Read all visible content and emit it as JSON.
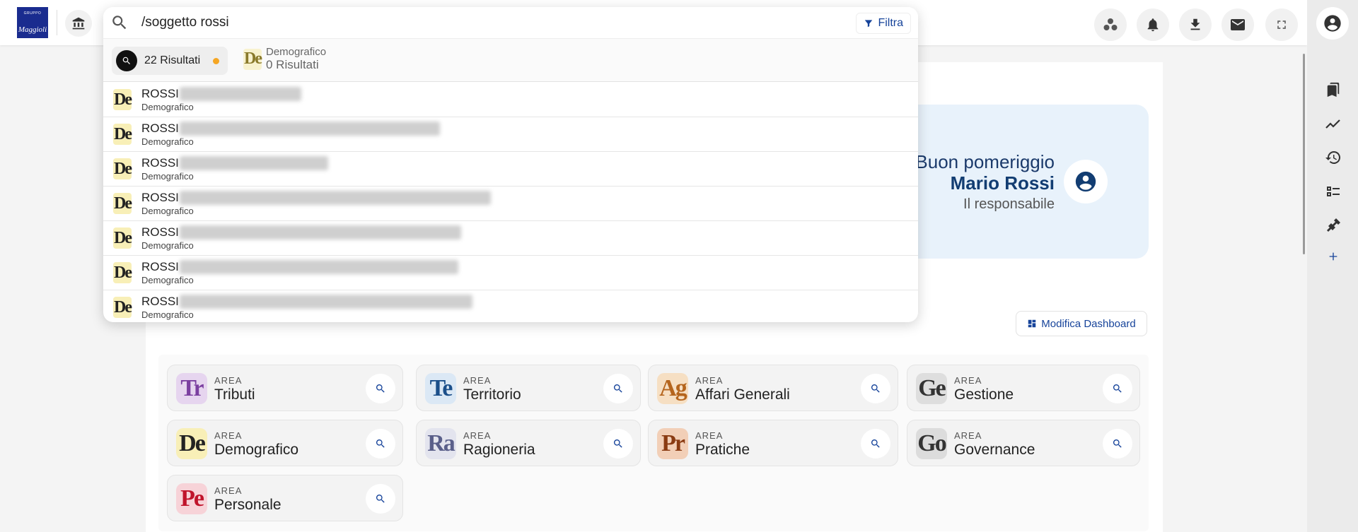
{
  "header": {
    "logo_top": "GRUPPO",
    "logo_text": "Maggioli"
  },
  "search": {
    "query": "/soggetto rossi",
    "filter_label": "Filtra",
    "tabs": [
      {
        "label": "22 Risultati"
      },
      {
        "category": "Demografico",
        "count_label": "0 Risultati"
      }
    ],
    "results": [
      {
        "name": "ROSSI",
        "category": "Demografico"
      },
      {
        "name": "ROSSI",
        "category": "Demografico"
      },
      {
        "name": "ROSSI",
        "category": "Demografico"
      },
      {
        "name": "ROSSI",
        "category": "Demografico"
      },
      {
        "name": "ROSSI",
        "category": "Demografico"
      },
      {
        "name": "ROSSI",
        "category": "Demografico"
      },
      {
        "name": "ROSSI",
        "category": "Demografico"
      }
    ],
    "result_badge": "De"
  },
  "welcome": {
    "greeting": "Buon pomeriggio",
    "user_name": "Mario Rossi",
    "role": "Il responsabile"
  },
  "dashboard": {
    "edit_label": "Modifica Dashboard"
  },
  "areas": [
    {
      "kicker": "AREA",
      "name": "Tributi",
      "badge": "Tr",
      "color": "#7b3fa0",
      "bg": "#e6d5ef"
    },
    {
      "kicker": "AREA",
      "name": "Territorio",
      "badge": "Te",
      "color": "#1b4f8a",
      "bg": "#dbe8f5"
    },
    {
      "kicker": "AREA",
      "name": "Affari Generali",
      "badge": "Ag",
      "color": "#b5651d",
      "bg": "#f6dfc3"
    },
    {
      "kicker": "AREA",
      "name": "Gestione",
      "badge": "Ge",
      "color": "#333333",
      "bg": "#dedede"
    },
    {
      "kicker": "AREA",
      "name": "Demografico",
      "badge": "De",
      "color": "#222222",
      "bg": "#f8efb7"
    },
    {
      "kicker": "AREA",
      "name": "Ragioneria",
      "badge": "Ra",
      "color": "#5a5f8a",
      "bg": "#e3e4ee"
    },
    {
      "kicker": "AREA",
      "name": "Pratiche",
      "badge": "Pr",
      "color": "#8a3b12",
      "bg": "#f2cfb7"
    },
    {
      "kicker": "AREA",
      "name": "Governance",
      "badge": "Go",
      "color": "#333333",
      "bg": "#dcdcdc"
    },
    {
      "kicker": "AREA",
      "name": "Personale",
      "badge": "Pe",
      "color": "#c0142b",
      "bg": "#f7d3d8"
    }
  ]
}
